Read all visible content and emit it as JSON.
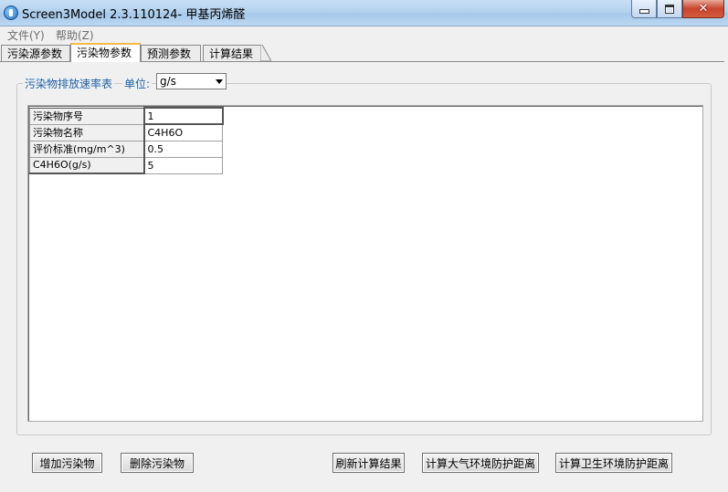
{
  "window": {
    "title": "Screen3Model 2.3.110124- 甲基丙烯醛"
  },
  "menu": {
    "file": "文件(Y)",
    "help": "帮助(Z)"
  },
  "tabs": [
    {
      "label": "污染源参数",
      "active": false
    },
    {
      "label": "污染物参数",
      "active": true
    },
    {
      "label": "预测参数",
      "active": false
    },
    {
      "label": "计算结果",
      "active": false
    }
  ],
  "group": {
    "caption": "污染物排放速率表",
    "unit_label": "单位:",
    "unit_value": "g/s"
  },
  "table": {
    "rows": [
      {
        "header": "污染物序号",
        "value": "1"
      },
      {
        "header": "污染物名称",
        "value": "C4H6O"
      },
      {
        "header": "评价标准(mg/m^3)",
        "value": "0.5"
      },
      {
        "header": "C4H6O(g/s)",
        "value": "5"
      }
    ]
  },
  "buttons": {
    "add": "增加污染物",
    "delete": "删除污染物",
    "refresh": "刷新计算结果",
    "air_distance": "计算大气环境防护距离",
    "health_distance": "计算卫生环境防护距离"
  },
  "colors": {
    "caption_blue": "#1d5fa6",
    "active_tab_accent": "#f6b94a"
  }
}
